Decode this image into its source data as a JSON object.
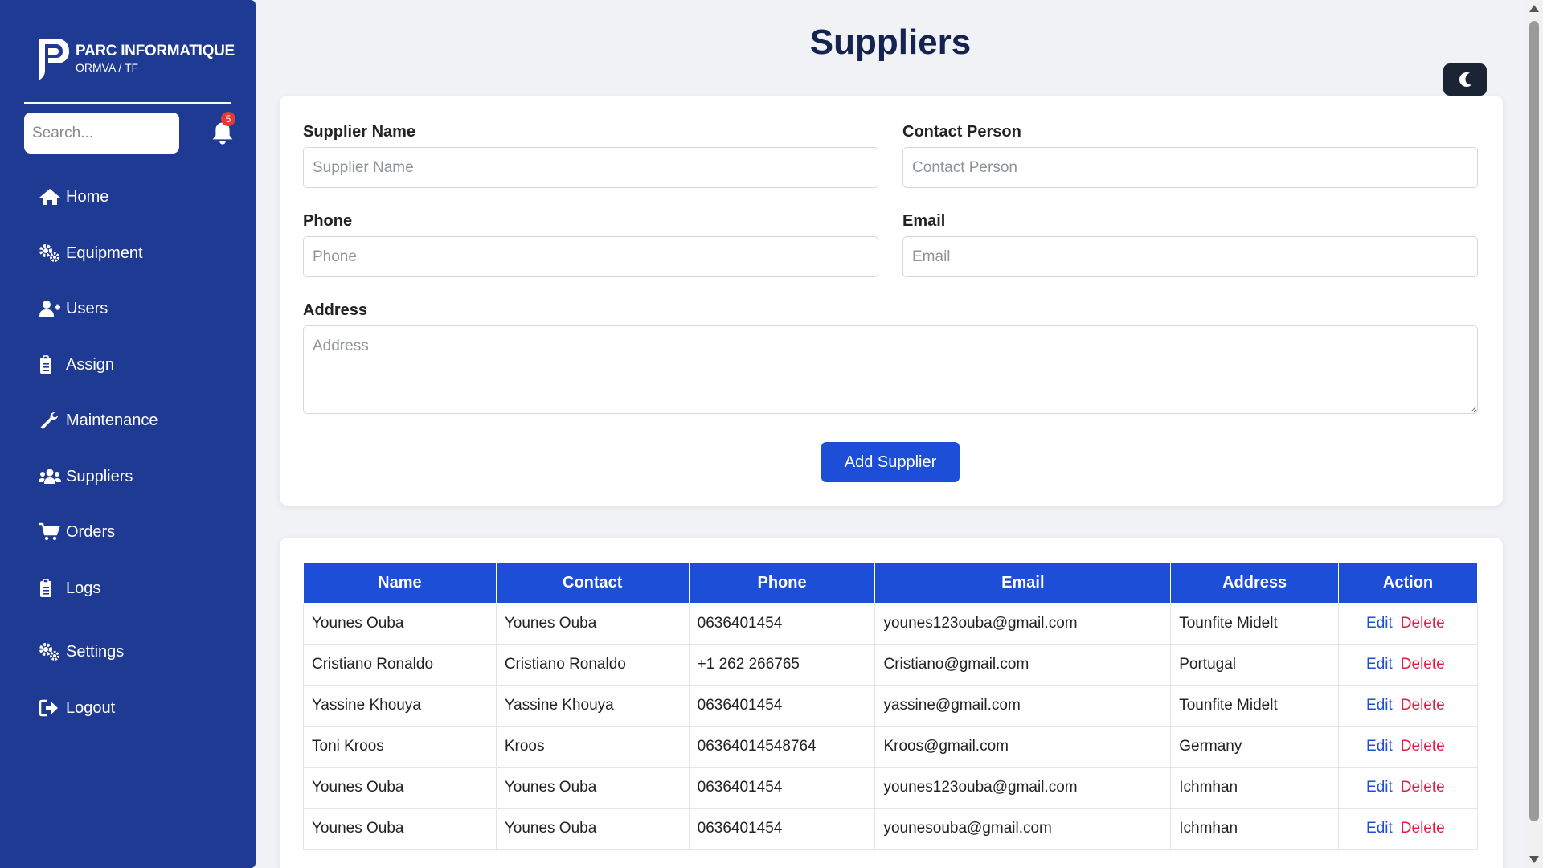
{
  "brand": {
    "title": "PARC INFORMATIQUE",
    "subtitle": "ORMVA / TF"
  },
  "search": {
    "placeholder": "Search..."
  },
  "notifications": {
    "count": "5"
  },
  "nav": [
    {
      "label": "Home",
      "icon": "home-icon"
    },
    {
      "label": "Equipment",
      "icon": "gears-icon"
    },
    {
      "label": "Users",
      "icon": "user-plus-icon"
    },
    {
      "label": "Assign",
      "icon": "clipboard-icon"
    },
    {
      "label": "Maintenance",
      "icon": "wrench-icon"
    },
    {
      "label": "Suppliers",
      "icon": "users-icon"
    },
    {
      "label": "Orders",
      "icon": "cart-icon"
    },
    {
      "label": "Logs",
      "icon": "clipboard-icon"
    },
    {
      "label": "Settings",
      "icon": "gears-icon"
    },
    {
      "label": "Logout",
      "icon": "logout-icon"
    }
  ],
  "page": {
    "title": "Suppliers"
  },
  "theme_toggle": {
    "icon": "moon-icon"
  },
  "form": {
    "supplier_name": {
      "label": "Supplier Name",
      "placeholder": "Supplier Name",
      "value": ""
    },
    "contact_person": {
      "label": "Contact Person",
      "placeholder": "Contact Person",
      "value": ""
    },
    "phone": {
      "label": "Phone",
      "placeholder": "Phone",
      "value": ""
    },
    "email": {
      "label": "Email",
      "placeholder": "Email",
      "value": ""
    },
    "address": {
      "label": "Address",
      "placeholder": "Address",
      "value": ""
    },
    "submit_label": "Add Supplier"
  },
  "table": {
    "headers": [
      "Name",
      "Contact",
      "Phone",
      "Email",
      "Address",
      "Action"
    ],
    "edit_label": "Edit",
    "delete_label": "Delete",
    "rows": [
      {
        "name": "Younes Ouba",
        "contact": "Younes Ouba",
        "phone": "0636401454",
        "email": "younes123ouba@gmail.com",
        "address": "Tounfite Midelt"
      },
      {
        "name": "Cristiano Ronaldo",
        "contact": "Cristiano Ronaldo",
        "phone": "+1 262 266765",
        "email": "Cristiano@gmail.com",
        "address": "Portugal"
      },
      {
        "name": "Yassine Khouya",
        "contact": "Yassine Khouya",
        "phone": "0636401454",
        "email": "yassine@gmail.com",
        "address": "Tounfite Midelt"
      },
      {
        "name": "Toni Kroos",
        "contact": "Kroos",
        "phone": "06364014548764",
        "email": "Kroos@gmail.com",
        "address": "Germany"
      },
      {
        "name": "Younes Ouba",
        "contact": "Younes Ouba",
        "phone": "0636401454",
        "email": "younes123ouba@gmail.com",
        "address": "Ichmhan"
      },
      {
        "name": "Younes Ouba",
        "contact": "Younes Ouba",
        "phone": "0636401454",
        "email": "younesouba@gmail.com",
        "address": "Ichmhan"
      }
    ]
  },
  "colors": {
    "sidebar": "#1f3a93",
    "primary": "#1d4ed8",
    "danger": "#e11d48",
    "title": "#14234f",
    "badge": "#e53935"
  }
}
